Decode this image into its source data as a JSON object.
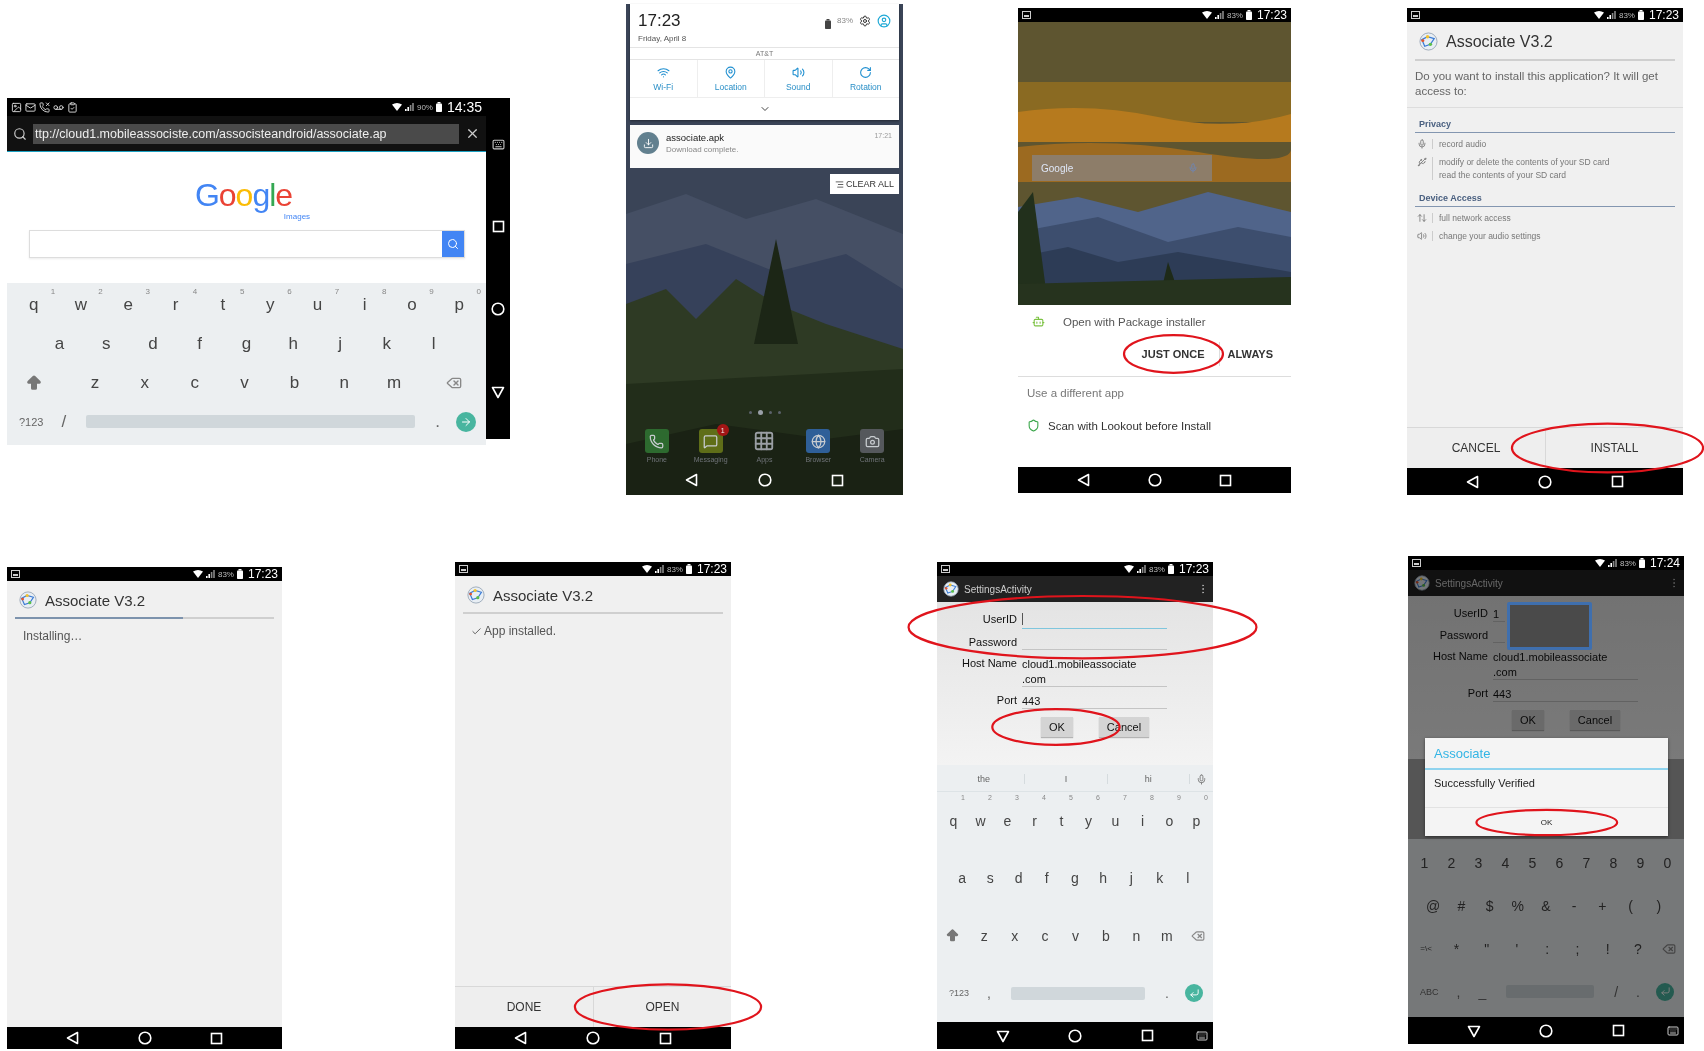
{
  "screens": [
    {
      "kind": "browser",
      "status_bar": {
        "time": "14:35",
        "battery": "90%"
      },
      "url": "ttp://cloud1.mobileassociste.com/associsteandroid/associate.ap",
      "logo": "Google",
      "logo_caption": "Images",
      "keyboard": {
        "kind": "letters",
        "action_key": {
          "kind": "go"
        },
        "rows": [
          {
            "keys": [
              {
                "label": "q",
                "hint": "1"
              },
              {
                "label": "w",
                "hint": "2"
              },
              {
                "label": "e",
                "hint": "3"
              },
              {
                "label": "r",
                "hint": "4"
              },
              {
                "label": "t",
                "hint": "5"
              },
              {
                "label": "y",
                "hint": "6"
              },
              {
                "label": "u",
                "hint": "7"
              },
              {
                "label": "i",
                "hint": "8"
              },
              {
                "label": "o",
                "hint": "9"
              },
              {
                "label": "p",
                "hint": "0"
              }
            ]
          },
          {
            "keys": [
              {
                "label": "a"
              },
              {
                "label": "s"
              },
              {
                "label": "d"
              },
              {
                "label": "f"
              },
              {
                "label": "g"
              },
              {
                "label": "h"
              },
              {
                "label": "j"
              },
              {
                "label": "k"
              },
              {
                "label": "l"
              }
            ]
          },
          {
            "keys": [
              {
                "label": "z"
              },
              {
                "label": "x"
              },
              {
                "label": "c"
              },
              {
                "label": "v"
              },
              {
                "label": "b"
              },
              {
                "label": "n"
              },
              {
                "label": "m"
              }
            ]
          }
        ],
        "bottom_left": [
          "?123",
          "/"
        ],
        "bottom_right": [
          "."
        ]
      },
      "nav_bar": {
        "keyboard_open": true
      }
    },
    {
      "kind": "notifications",
      "time": "17:23",
      "date": "Friday, April 8",
      "battery": "83%",
      "carrier": "AT&T",
      "tiles": [
        {
          "kind": "wifi",
          "label": "Wi-Fi"
        },
        {
          "kind": "location",
          "label": "Location"
        },
        {
          "kind": "sound",
          "label": "Sound"
        },
        {
          "kind": "rotation",
          "label": "Rotation"
        }
      ],
      "notification": {
        "title": "associate.apk",
        "text": "Download complete.",
        "time": "17:21"
      },
      "clear_all": "CLEAR ALL",
      "page_dots": [
        {
          "selected": false
        },
        {
          "selected": true
        },
        {
          "selected": false
        },
        {
          "selected": false
        }
      ],
      "dock": [
        {
          "kind": "phone",
          "label": "Phone"
        },
        {
          "kind": "messaging",
          "label": "Messaging",
          "badge": "1"
        },
        {
          "kind": "apps",
          "label": "Apps"
        },
        {
          "kind": "browser",
          "label": "Browser"
        },
        {
          "kind": "camera",
          "label": "Camera"
        }
      ],
      "nav_bar": {
        "keyboard_open": false
      }
    },
    {
      "kind": "chooser",
      "status_bar": {
        "time": "17:23",
        "battery": "83%"
      },
      "search_widget": {
        "logo": "Google"
      },
      "prompt": "Open with Package installer",
      "buttons": [
        {
          "label": "JUST ONCE",
          "circled": true
        },
        {
          "label": "ALWAYS",
          "circled": false
        }
      ],
      "alternative": "Use a different app",
      "scan": "Scan with Lookout before Install",
      "nav_bar": {
        "keyboard_open": false
      }
    },
    {
      "kind": "install",
      "status_bar": {
        "time": "17:23",
        "battery": "83%"
      },
      "app_title": "Associate V3.2",
      "question": "Do you want to install this application? It will get access to:",
      "sections": [
        {
          "title": "Privacy",
          "items": [
            {
              "kind": "microphone",
              "lines": [
                "record audio"
              ]
            },
            {
              "kind": "storage",
              "lines": [
                "modify or delete the contents of your SD card",
                "read the contents of your SD card"
              ]
            }
          ]
        },
        {
          "title": "Device Access",
          "items": [
            {
              "kind": "network",
              "lines": [
                "full network access"
              ]
            },
            {
              "kind": "audio",
              "lines": [
                "change your audio settings"
              ]
            }
          ]
        }
      ],
      "buttons": [
        {
          "label": "CANCEL",
          "circled": false
        },
        {
          "label": "INSTALL",
          "circled": true
        }
      ],
      "nav_bar": {
        "keyboard_open": false
      }
    },
    {
      "kind": "installing",
      "status_bar": {
        "time": "17:23",
        "battery": "83%"
      },
      "app_title": "Associate V3.2",
      "level": 0.65,
      "message": "Installing…",
      "nav_bar": {
        "keyboard_open": false
      }
    },
    {
      "kind": "installed",
      "status_bar": {
        "time": "17:23",
        "battery": "83%"
      },
      "app_title": "Associate V3.2",
      "message": "App installed.",
      "buttons": [
        {
          "label": "DONE",
          "circled": false
        },
        {
          "label": "OPEN",
          "circled": true
        }
      ],
      "nav_bar": {
        "keyboard_open": false
      }
    },
    {
      "kind": "settings",
      "status_bar": {
        "time": "17:23",
        "battery": "83%"
      },
      "app_bar": "SettingsActivity",
      "fields": [
        {
          "label": "UserID",
          "focused": true,
          "circled": true
        },
        {
          "label": "Password",
          "focused": false,
          "circled": true
        },
        {
          "label": "Host Name",
          "value_lines": [
            "cloud1.mobileassociate",
            ".com"
          ],
          "focused": false,
          "circled": false
        },
        {
          "label": "Port",
          "value_lines": [
            "443"
          ],
          "focused": false,
          "circled": false
        }
      ],
      "buttons": [
        {
          "label": "OK",
          "circled": true
        },
        {
          "label": "Cancel",
          "circled": false
        }
      ],
      "keyboard": {
        "kind": "letters",
        "action_key": {
          "kind": "enter"
        },
        "suggestions": [
          "the",
          "I",
          "hi"
        ],
        "rows": [
          {
            "keys": [
              {
                "label": "q",
                "hint": "1"
              },
              {
                "label": "w",
                "hint": "2"
              },
              {
                "label": "e",
                "hint": "3"
              },
              {
                "label": "r",
                "hint": "4"
              },
              {
                "label": "t",
                "hint": "5"
              },
              {
                "label": "y",
                "hint": "6"
              },
              {
                "label": "u",
                "hint": "7"
              },
              {
                "label": "i",
                "hint": "8"
              },
              {
                "label": "o",
                "hint": "9"
              },
              {
                "label": "p",
                "hint": "0"
              }
            ]
          },
          {
            "keys": [
              {
                "label": "a"
              },
              {
                "label": "s"
              },
              {
                "label": "d"
              },
              {
                "label": "f"
              },
              {
                "label": "g"
              },
              {
                "label": "h"
              },
              {
                "label": "j"
              },
              {
                "label": "k"
              },
              {
                "label": "l"
              }
            ]
          },
          {
            "keys": [
              {
                "label": "z"
              },
              {
                "label": "x"
              },
              {
                "label": "c"
              },
              {
                "label": "v"
              },
              {
                "label": "b"
              },
              {
                "label": "n"
              },
              {
                "label": "m"
              }
            ]
          }
        ],
        "bottom_left": [
          "?123",
          ","
        ],
        "bottom_right": [
          "."
        ]
      },
      "nav_bar": {
        "keyboard_open": true
      }
    },
    {
      "kind": "verified",
      "status_bar": {
        "time": "17:24",
        "battery": "83%"
      },
      "app_bar": "SettingsActivity",
      "fields": [
        {
          "label": "UserID",
          "value_lines": [
            "1"
          ],
          "focused": false,
          "circled": false
        },
        {
          "label": "Password",
          "focused": false,
          "circled": false
        },
        {
          "label": "Host Name",
          "value_lines": [
            "cloud1.mobileassociate",
            ".com"
          ],
          "focused": false,
          "circled": false
        },
        {
          "label": "Port",
          "value_lines": [
            "443"
          ],
          "focused": false,
          "circled": false
        }
      ],
      "redacted": true,
      "buttons": [
        {
          "label": "OK",
          "circled": false
        },
        {
          "label": "Cancel",
          "circled": false
        }
      ],
      "dialog": {
        "title": "Associate",
        "message": "Successfully Verified",
        "button": {
          "label": "OK",
          "circled": true
        }
      },
      "keyboard": {
        "kind": "symbols",
        "action_key": {
          "kind": "enter"
        },
        "rows": [
          {
            "keys": [
              {
                "label": "1"
              },
              {
                "label": "2"
              },
              {
                "label": "3"
              },
              {
                "label": "4"
              },
              {
                "label": "5"
              },
              {
                "label": "6"
              },
              {
                "label": "7"
              },
              {
                "label": "8"
              },
              {
                "label": "9"
              },
              {
                "label": "0"
              }
            ]
          },
          {
            "keys": [
              {
                "label": "@"
              },
              {
                "label": "#"
              },
              {
                "label": "$"
              },
              {
                "label": "%"
              },
              {
                "label": "&"
              },
              {
                "label": "-"
              },
              {
                "label": "+"
              },
              {
                "label": "("
              },
              {
                "label": ")"
              }
            ]
          },
          {
            "keys": [
              {
                "label": "=\\<"
              },
              {
                "label": "*"
              },
              {
                "label": "\""
              },
              {
                "label": "'"
              },
              {
                "label": ":"
              },
              {
                "label": ";"
              },
              {
                "label": "!"
              },
              {
                "label": "?"
              }
            ]
          }
        ],
        "bottom_left": [
          "ABC",
          ",",
          "_"
        ],
        "bottom_right": [
          "/",
          "."
        ]
      },
      "nav_bar": {
        "keyboard_open": true
      }
    }
  ]
}
